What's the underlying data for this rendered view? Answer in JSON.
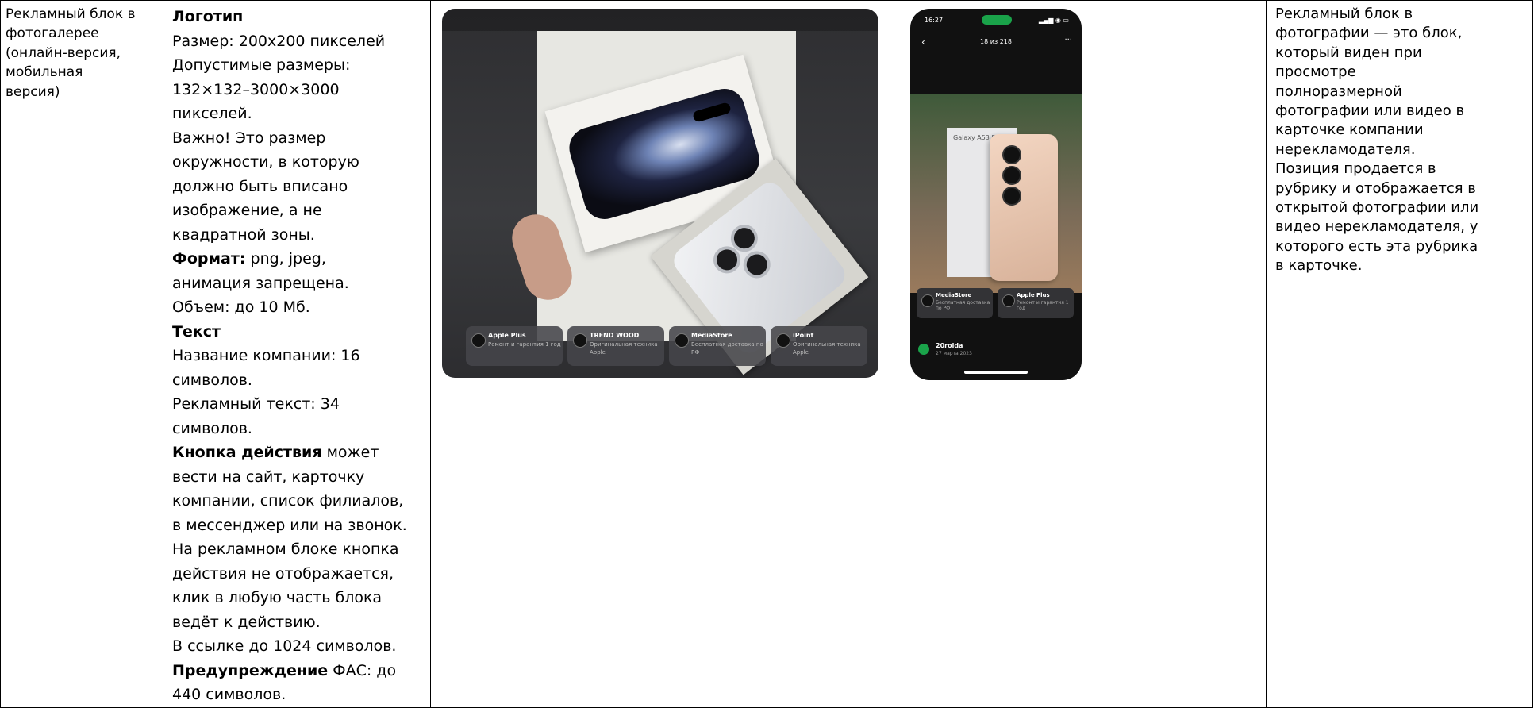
{
  "col1": {
    "lines": [
      "Рекламный блок в",
      "фотогалерее",
      "(онлайн-версия,",
      "мобильная",
      "версия)"
    ]
  },
  "col2": {
    "logo_heading": "Логотип",
    "size_line": "Размер: 200х200 пикселей",
    "allowed_1": "Допустимые размеры:",
    "allowed_2": "132×132–3000×3000",
    "allowed_3": "пикселей.",
    "important_1": "Важно! Это размер",
    "important_2": "окружности, в которую",
    "important_3": "должно быть вписано",
    "important_4": "изображение, а не",
    "important_5": "квадратной зоны.",
    "format_label": "Формат:",
    "format_value": " png, jpeg,",
    "format_2": "анимация запрещена.",
    "volume": "Объем: до 10 Мб.",
    "text_heading": "Текст",
    "name_1": "Название компании: 16",
    "name_2": "символов.",
    "ad_text_1": "Рекламный текст: 34",
    "ad_text_2": "символов.",
    "action_label": "Кнопка действия",
    "action_1_rest": " может",
    "action_2": "вести на сайт, карточку",
    "action_3": "компании, список филиалов,",
    "action_4": "в мессенджер или на звонок.",
    "action_5": "На рекламном блоке кнопка",
    "action_6": "действия не отображается,",
    "action_7": "клик в любую часть блока",
    "action_8": "ведёт к действию.",
    "link_limit": "В ссылке до 1024 символов.",
    "warning_label": "Предупреждение",
    "warning_rest": " ФАС: до",
    "warning_2": "440 символов."
  },
  "screenshot1": {
    "ads": [
      {
        "title": "Apple Plus",
        "sub": "Ремонт и гарантия 1 год"
      },
      {
        "title": "TREND WOOD",
        "sub": "Оригинальная техника Apple"
      },
      {
        "title": "MediaStore",
        "sub": "Бесплатная доставка по РФ"
      },
      {
        "title": "iPoint",
        "sub": "Оригинальная техника Apple"
      }
    ]
  },
  "screenshot2": {
    "time": "16:27",
    "counter": "18 из 218",
    "box_label": "Galaxy A53 5G",
    "ads": [
      {
        "title": "MediaStore",
        "sub": "Бесплатная доставка по РФ"
      },
      {
        "title": "Apple Plus",
        "sub": "Ремонт и гарантия 1 год"
      }
    ],
    "author_name": "20roida",
    "author_date": "27 марта 2023"
  },
  "col4": {
    "lines": [
      "Рекламный блок в",
      "фотографии — это блок,",
      "который виден при",
      "просмотре",
      "полноразмерной",
      "фотографии или видео в",
      "карточке компании",
      "нерекламодателя.",
      "Позиция продается в",
      "рубрику и отображается в",
      "открытой фотографии или",
      "видео нерекламодателя, у",
      "которого есть эта рубрика",
      "в карточке."
    ]
  }
}
